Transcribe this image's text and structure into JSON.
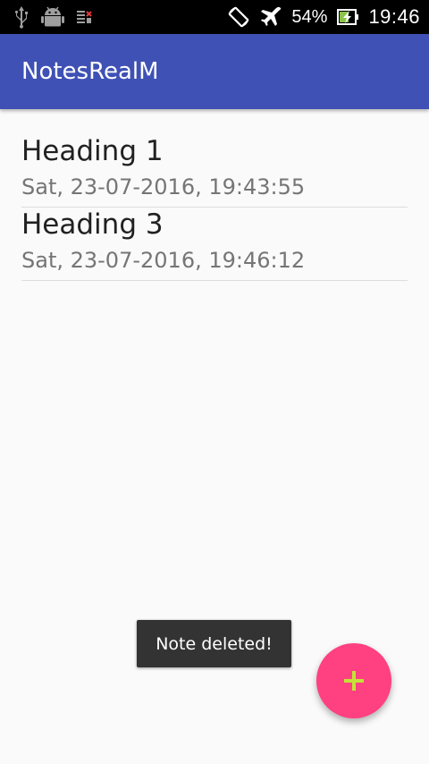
{
  "status_bar": {
    "left_icons": [
      "usb-icon",
      "android-debug-icon",
      "sim-icon"
    ],
    "right_icons": [
      "screen-rotation-icon",
      "airplane-mode-icon",
      "battery-charging-icon"
    ],
    "battery_percent": "54%",
    "time": "19:46"
  },
  "app_bar": {
    "title": "NotesRealM",
    "color": "#3f51b5"
  },
  "notes": [
    {
      "heading": "Heading 1",
      "date": "Sat, 23-07-2016, 19:43:55"
    },
    {
      "heading": "Heading 3",
      "date": "Sat, 23-07-2016, 19:46:12"
    }
  ],
  "toast": {
    "message": "Note deleted!"
  },
  "fab": {
    "icon": "plus-icon",
    "color": "#ff4081",
    "icon_color": "#c6e03a"
  }
}
